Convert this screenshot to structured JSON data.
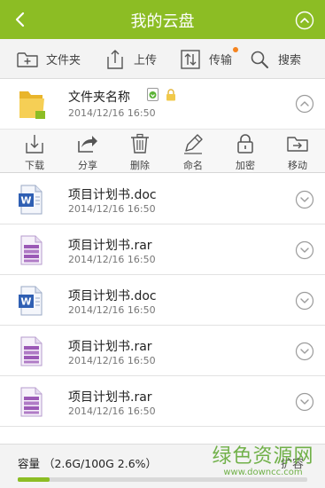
{
  "header": {
    "title": "我的云盘",
    "accent": "#8cbd24",
    "left_icon": "back-arrow-icon",
    "right_icon": "chevron-up-icon"
  },
  "toolbar": {
    "items": [
      {
        "label": "文件夹",
        "icon": "new-folder-icon"
      },
      {
        "label": "上传",
        "icon": "upload-icon"
      },
      {
        "label": "传输",
        "icon": "transfer-icon",
        "badge_color": "#f5841f"
      },
      {
        "label": "搜索",
        "icon": "search-icon"
      }
    ]
  },
  "folder": {
    "name": "文件夹名称",
    "time": "2014/12/16  16:50",
    "icon": "folder-icon",
    "status_icons": [
      "download-status-icon",
      "lock-icon"
    ],
    "expanded": true
  },
  "actions": [
    {
      "label": "下载",
      "icon": "download-icon"
    },
    {
      "label": "分享",
      "icon": "share-icon"
    },
    {
      "label": "删除",
      "icon": "trash-icon"
    },
    {
      "label": "命名",
      "icon": "pencil-icon"
    },
    {
      "label": "加密",
      "icon": "lock-icon"
    },
    {
      "label": "移动",
      "icon": "move-icon"
    }
  ],
  "files": [
    {
      "name": "项目计划书.doc",
      "time": "2014/12/16  16:50",
      "type": "doc"
    },
    {
      "name": "项目计划书.rar",
      "time": "2014/12/16  16:50",
      "type": "rar"
    },
    {
      "name": "项目计划书.doc",
      "time": "2014/12/16  16:50",
      "type": "doc"
    },
    {
      "name": "项目计划书.rar",
      "time": "2014/12/16  16:50",
      "type": "rar"
    },
    {
      "name": "项目计划书.rar",
      "time": "2014/12/16  16:50",
      "type": "rar"
    }
  ],
  "capacity": {
    "label": "容量 （2.6G/100G 2.6%）",
    "used_percent": 2.6,
    "expand_label": "扩容"
  },
  "watermark": {
    "main": "绿色资源网",
    "sub": "www.downcc.com"
  }
}
